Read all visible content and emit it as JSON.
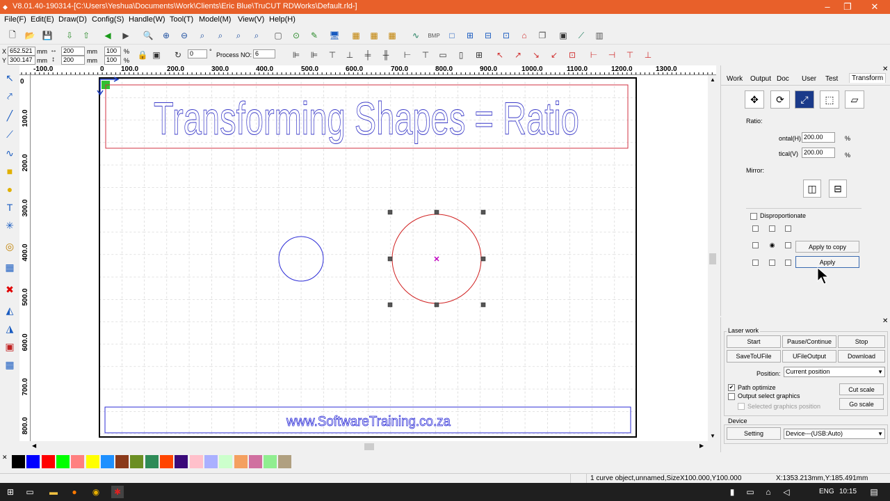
{
  "window": {
    "title": "V8.01.40-190314-[C:\\Users\\Yeshua\\Documents\\Work\\Clients\\Eric Blue\\TruCUT RDWorks\\Default.rld-]",
    "minimize": "–",
    "maximize": "❐",
    "close": "✕"
  },
  "menu": [
    "File(F)",
    "Edit(E)",
    "Draw(D)",
    "Config(S)",
    "Handle(W)",
    "Tool(T)",
    "Model(M)",
    "View(V)",
    "Help(H)"
  ],
  "toolbar2": {
    "x_label": "X",
    "x_value": "652.521",
    "x_unit": "mm",
    "y_label": "Y",
    "y_value": "300.147",
    "y_unit": "mm",
    "w_value": "200",
    "w_unit": "mm",
    "h_value": "200",
    "h_unit": "mm",
    "w_pct": "100",
    "h_pct": "100",
    "pct": "%",
    "angle_value": "0",
    "angle_unit": "°",
    "process_label": "Process NO:",
    "process_value": "6"
  },
  "ruler": {
    "h_ticks": [
      "-100.0",
      "0",
      "100.0",
      "200.0",
      "300.0",
      "400.0",
      "500.0",
      "600.0",
      "700.0",
      "800.0",
      "900.0",
      "1000.0",
      "1100.0",
      "1200.0",
      "1300.0"
    ],
    "v_ticks": [
      "0",
      "100.0",
      "200.0",
      "300.0",
      "400.0",
      "500.0",
      "600.0",
      "700.0",
      "800.0"
    ]
  },
  "canvas": {
    "headline": "Transforming Shapes = Ratio",
    "footer_text": "www.SoftwareTraining.co.za",
    "colors": {
      "blue": "#2b2bd6",
      "red": "#d02020",
      "center_mark": "#c000c0"
    }
  },
  "transform_panel": {
    "tabs": [
      "Work",
      "Output",
      "Doc",
      "User",
      "Test",
      "Transform"
    ],
    "ratio_label": "Ratio:",
    "horizontal_label": "ontal(H)",
    "horizontal_value": "200.00",
    "vertical_label": "tical(V)",
    "vertical_value": "200.00",
    "pct": "%",
    "mirror_label": "Mirror:",
    "disproportionate_label": "Disproportionate",
    "apply_to_copy": "Apply to copy",
    "apply": "Apply"
  },
  "laser_work": {
    "group_label": "Laser work",
    "start": "Start",
    "pause": "Pause/Continue",
    "stop": "Stop",
    "save_to_ufile": "SaveToUFile",
    "ufile_output": "UFileOutput",
    "download": "Download",
    "position_label": "Position:",
    "position_value": "Current position",
    "path_optimize": "Path optimize",
    "output_select": "Output select graphics",
    "selected_position": "Selected graphics position",
    "cut_scale": "Cut scale",
    "go_scale": "Go scale",
    "device_label": "Device",
    "setting": "Setting",
    "device_value": "Device---(USB:Auto)"
  },
  "palette": [
    "#000000",
    "#0000ff",
    "#ff0000",
    "#00ff00",
    "#ff8080",
    "#ffff00",
    "#1e90ff",
    "#8b3a1a",
    "#6b8e23",
    "#2e8b57",
    "#ff4500",
    "#3a0a7a",
    "#ffc0cb",
    "#aab0ff",
    "#ccffcc",
    "#f4a060",
    "#d070a0",
    "#90ee90",
    "#b0a080"
  ],
  "status": {
    "object_info": "1 curve object,unnamed,SizeX100.000,Y100.000",
    "coords": "X:1353.213mm,Y:185.491mm"
  },
  "taskbar": {
    "lang": "ENG",
    "time": "10:15"
  }
}
